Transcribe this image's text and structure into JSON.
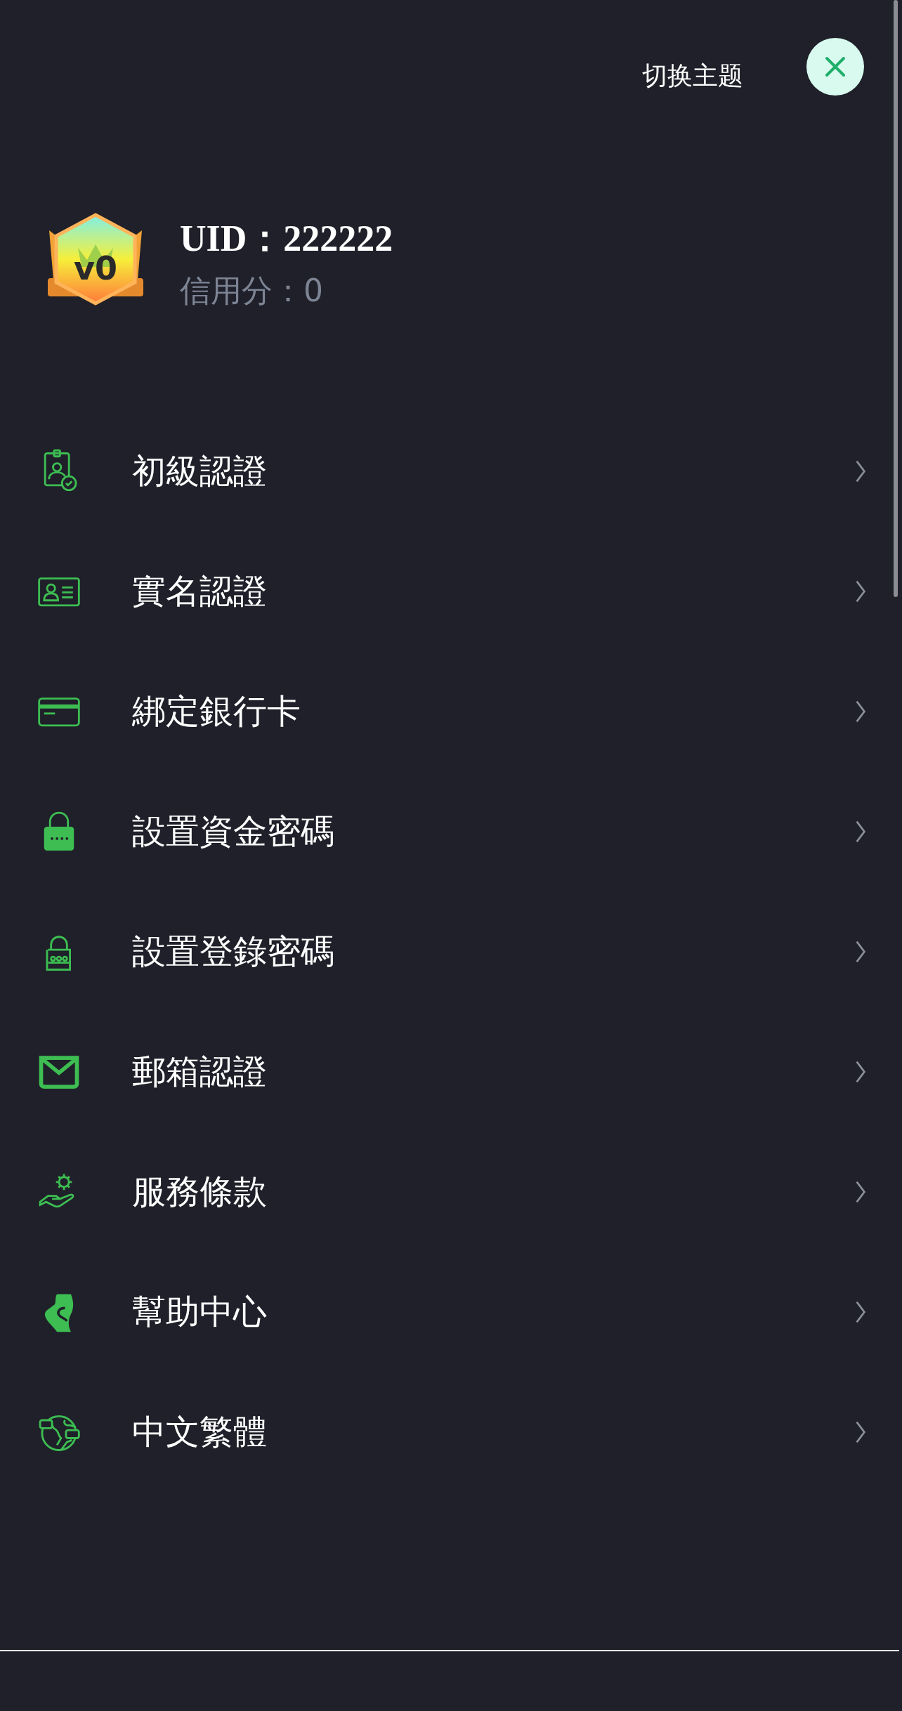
{
  "header": {
    "theme_switch": "切换主题"
  },
  "profile": {
    "level_badge": "v0",
    "uid": "UID：222222",
    "credit": "信用分：0"
  },
  "menu": [
    {
      "label": "初級認證"
    },
    {
      "label": "實名認證"
    },
    {
      "label": "綁定銀行卡"
    },
    {
      "label": "設置資金密碼"
    },
    {
      "label": "設置登錄密碼"
    },
    {
      "label": "郵箱認證"
    },
    {
      "label": "服務條款"
    },
    {
      "label": "幫助中心"
    },
    {
      "label": "中文繁體"
    }
  ]
}
